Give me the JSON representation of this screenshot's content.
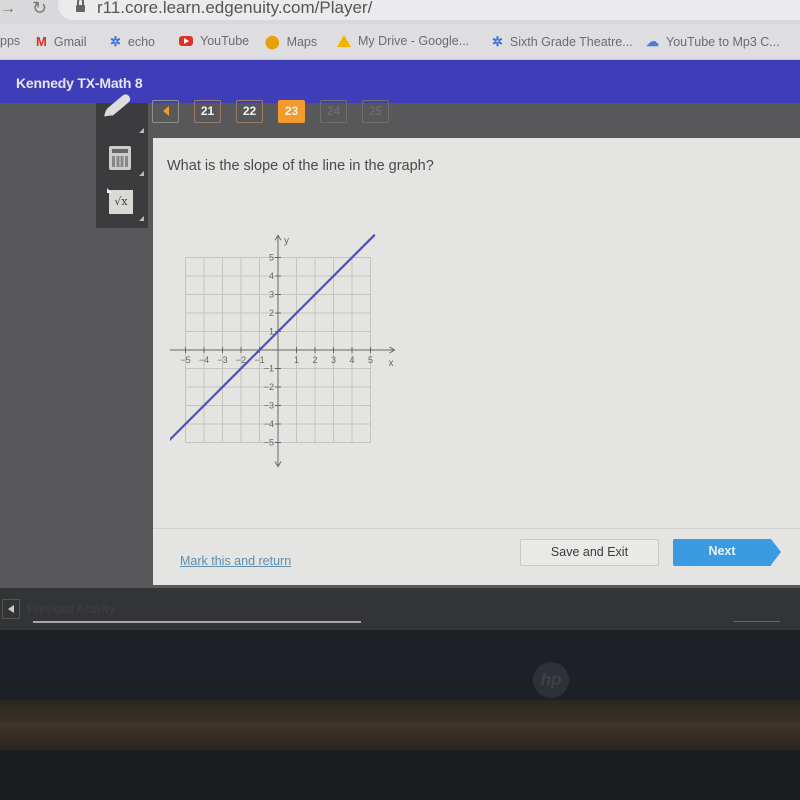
{
  "browser": {
    "url": "r11.core.learn.edgenuity.com/Player/",
    "bookmarks": [
      {
        "label": "pps",
        "icon": "apps-icon"
      },
      {
        "label": "Gmail",
        "icon": "gmail-icon"
      },
      {
        "label": "echo",
        "icon": "echo-icon"
      },
      {
        "label": "YouTube",
        "icon": "youtube-icon"
      },
      {
        "label": "Maps",
        "icon": "maps-icon"
      },
      {
        "label": "My Drive - Google...",
        "icon": "drive-icon"
      },
      {
        "label": "Sixth Grade Theatre...",
        "icon": "echo-icon"
      },
      {
        "label": "YouTube to Mp3 C...",
        "icon": "cloud-download-icon"
      }
    ]
  },
  "header": {
    "course_title": "Kennedy TX-Math 8",
    "accent_color": "#3e3fb8"
  },
  "tools": [
    "pencil-icon",
    "calculator-icon",
    "formula-sqrt-icon"
  ],
  "pager": {
    "prev_icon": "triangle-left-icon",
    "pages": [
      {
        "label": "21",
        "state": "visited"
      },
      {
        "label": "22",
        "state": "visited"
      },
      {
        "label": "23",
        "state": "current"
      },
      {
        "label": "24",
        "state": "disabled"
      },
      {
        "label": "25",
        "state": "disabled"
      }
    ],
    "current_color": "#f39a2a"
  },
  "question": {
    "text": "What is the slope of the line in the graph?"
  },
  "graph": {
    "x_label": "x",
    "y_label": "y",
    "x_range": [
      -5,
      5
    ],
    "y_range": [
      -5,
      5
    ],
    "x_ticks": [
      "-5",
      "-4",
      "-3",
      "-2",
      "-1",
      "1",
      "2",
      "3",
      "4",
      "5"
    ],
    "y_ticks": [
      "5",
      "4",
      "3",
      "2",
      "1",
      "-1",
      "-2",
      "-3",
      "-4",
      "-5"
    ],
    "line": {
      "points": [
        [
          -6,
          -5
        ],
        [
          5.2,
          6.2
        ]
      ],
      "passes_through": [
        [
          -1,
          0
        ],
        [
          0,
          1
        ]
      ],
      "color": "#4a4fbf"
    }
  },
  "footer": {
    "mark_link": "Mark this and return",
    "save_exit": "Save and Exit",
    "next": "Next",
    "next_color": "#3a9be0"
  },
  "bottom_bar": {
    "prev_activity_label": "Previous Activity"
  },
  "device": {
    "logo": "hp"
  }
}
